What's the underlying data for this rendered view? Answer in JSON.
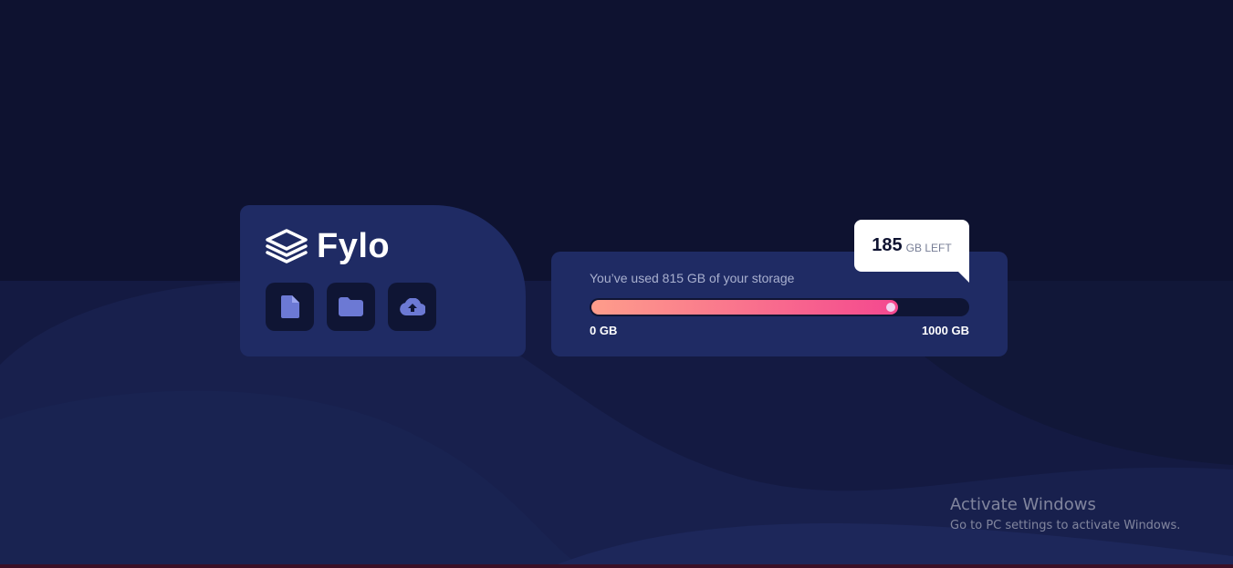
{
  "brand": {
    "name": "Fylo",
    "logo_icon": "stacked-layers-icon"
  },
  "actions": [
    {
      "icon": "document-icon"
    },
    {
      "icon": "folder-icon"
    },
    {
      "icon": "cloud-upload-icon"
    }
  ],
  "storage": {
    "usage_text": "You’ve used 815 GB of your storage",
    "used_fraction": 0.815,
    "scale_min": "0 GB",
    "scale_max": "1000 GB",
    "remaining_value": "185",
    "remaining_unit": "GB LEFT"
  },
  "watermark": {
    "title": "Activate Windows",
    "subtitle": "Go to PC settings to activate Windows."
  },
  "colors": {
    "background": "#0e1230",
    "card": "#1f2b64",
    "icon_bg": "#0f1534",
    "gradient_start": "#fe9d8b",
    "gradient_end": "#f4488f",
    "icon_accent": "#6c79d4"
  }
}
